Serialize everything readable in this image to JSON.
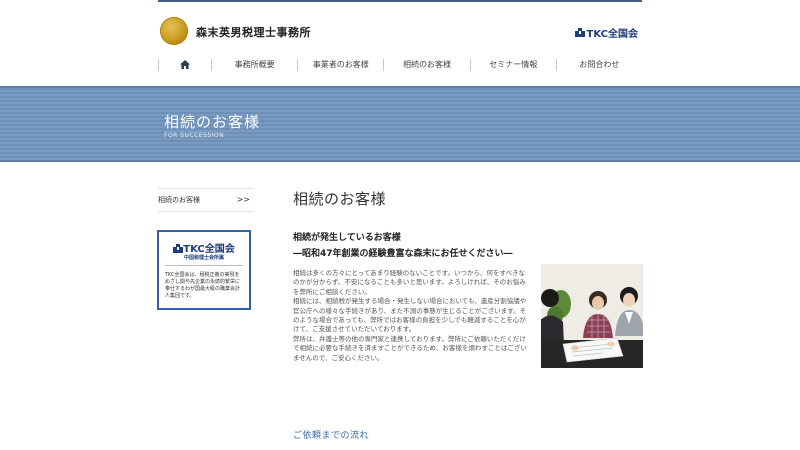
{
  "header": {
    "site_title": "森末英男税理士事務所",
    "tkc_label": "TKC全国会"
  },
  "nav": {
    "items": [
      {
        "label": "事務所概要"
      },
      {
        "label": "事業者のお客様"
      },
      {
        "label": "相続のお客様"
      },
      {
        "label": "セミナー情報"
      },
      {
        "label": "お問合わせ"
      }
    ]
  },
  "banner": {
    "title": "相続のお客様",
    "subtitle": "FOR SUCCESSION"
  },
  "sidebar": {
    "link_label": "相続のお客様",
    "link_arrow": ">>",
    "tkc_box": {
      "brand": "TKC全国会",
      "sub": "中国税理士会所属",
      "desc": "TKC全国会は、租税正義の実現をめざし関与先企業の永続的繁栄に奉仕するわが国最大級の職業会計人集団です。"
    }
  },
  "main": {
    "title": "相続のお客様",
    "headline_1": "相続が発生しているお客様",
    "headline_2": "―昭和47年創業の経験豊富な森末にお任せください―",
    "paragraphs": [
      "相続は多くの方々にとってあまり経験のないことです。いつから、何をすべきなのかが分からず、不安になることも多いと思います。よろしければ、そのお悩みを弊所にご相談ください。",
      "相続には、相続税が発生する場合・発生しない場合においても、遺産分割協議や官公庁への様々な手続きがあり、また不測の事態が生じることがございます。そのような場合であっても、弊所ではお客様の負担を少しでも軽減することを心がけて、ご支援させていただいております。",
      "弊所は、弁護士等の他の専門家と連携しております。弊所にご依頼いただくだけで相続に必要な手続きを済ますことができるため、お客様を煩わすことはございませんので、ご安心ください。"
    ],
    "flow_link": "ご依頼までの流れ"
  },
  "colors": {
    "accent": "#3e5f87",
    "banner": "#7393ba",
    "tkc_blue": "#1f3d7a",
    "link": "#3a6aa6"
  }
}
